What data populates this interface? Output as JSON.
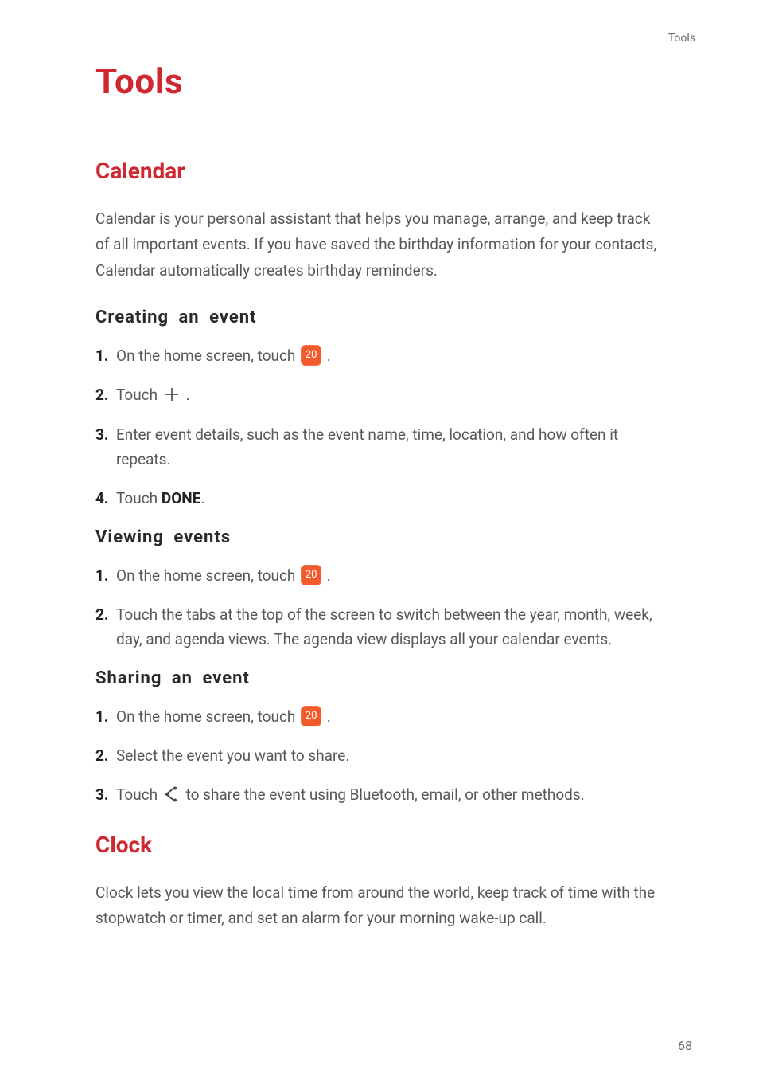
{
  "header_label": "Tools",
  "page_number": "68",
  "title": "Tools",
  "calendar": {
    "heading": "Calendar",
    "intro": "Calendar is your personal assistant that helps you manage, arrange, and keep track of all important events. If you have saved the birthday information for your contacts, Calendar automatically creates birthday reminders.",
    "creating": {
      "heading": "Creating an event",
      "steps": {
        "n1": "1.",
        "s1a": "On the home screen, touch ",
        "s1b": " .",
        "n2": "2.",
        "s2a": "Touch ",
        "s2b": " .",
        "n3": "3.",
        "s3": "Enter event details, such as the event name, time, location, and how often it repeats.",
        "n4": "4.",
        "s4a": "Touch ",
        "s4b": "DONE",
        "s4c": "."
      }
    },
    "viewing": {
      "heading": "Viewing events",
      "steps": {
        "n1": "1.",
        "s1a": "On the home screen, touch ",
        "s1b": " .",
        "n2": "2.",
        "s2": "Touch the tabs at the top of the screen to switch between the year, month, week, day, and agenda views. The agenda view displays all your calendar events."
      }
    },
    "sharing": {
      "heading": "Sharing an event",
      "steps": {
        "n1": "1.",
        "s1a": "On the home screen, touch ",
        "s1b": " .",
        "n2": "2.",
        "s2": "Select the event you want to share.",
        "n3": "3.",
        "s3a": "Touch ",
        "s3b": " to share the event using Bluetooth, email, or other methods."
      }
    }
  },
  "clock": {
    "heading": "Clock",
    "intro": "Clock lets you view the local time from around the world, keep track of time with the stopwatch or timer, and set an alarm for your morning wake-up call."
  },
  "icons": {
    "calendar_label": "20"
  }
}
